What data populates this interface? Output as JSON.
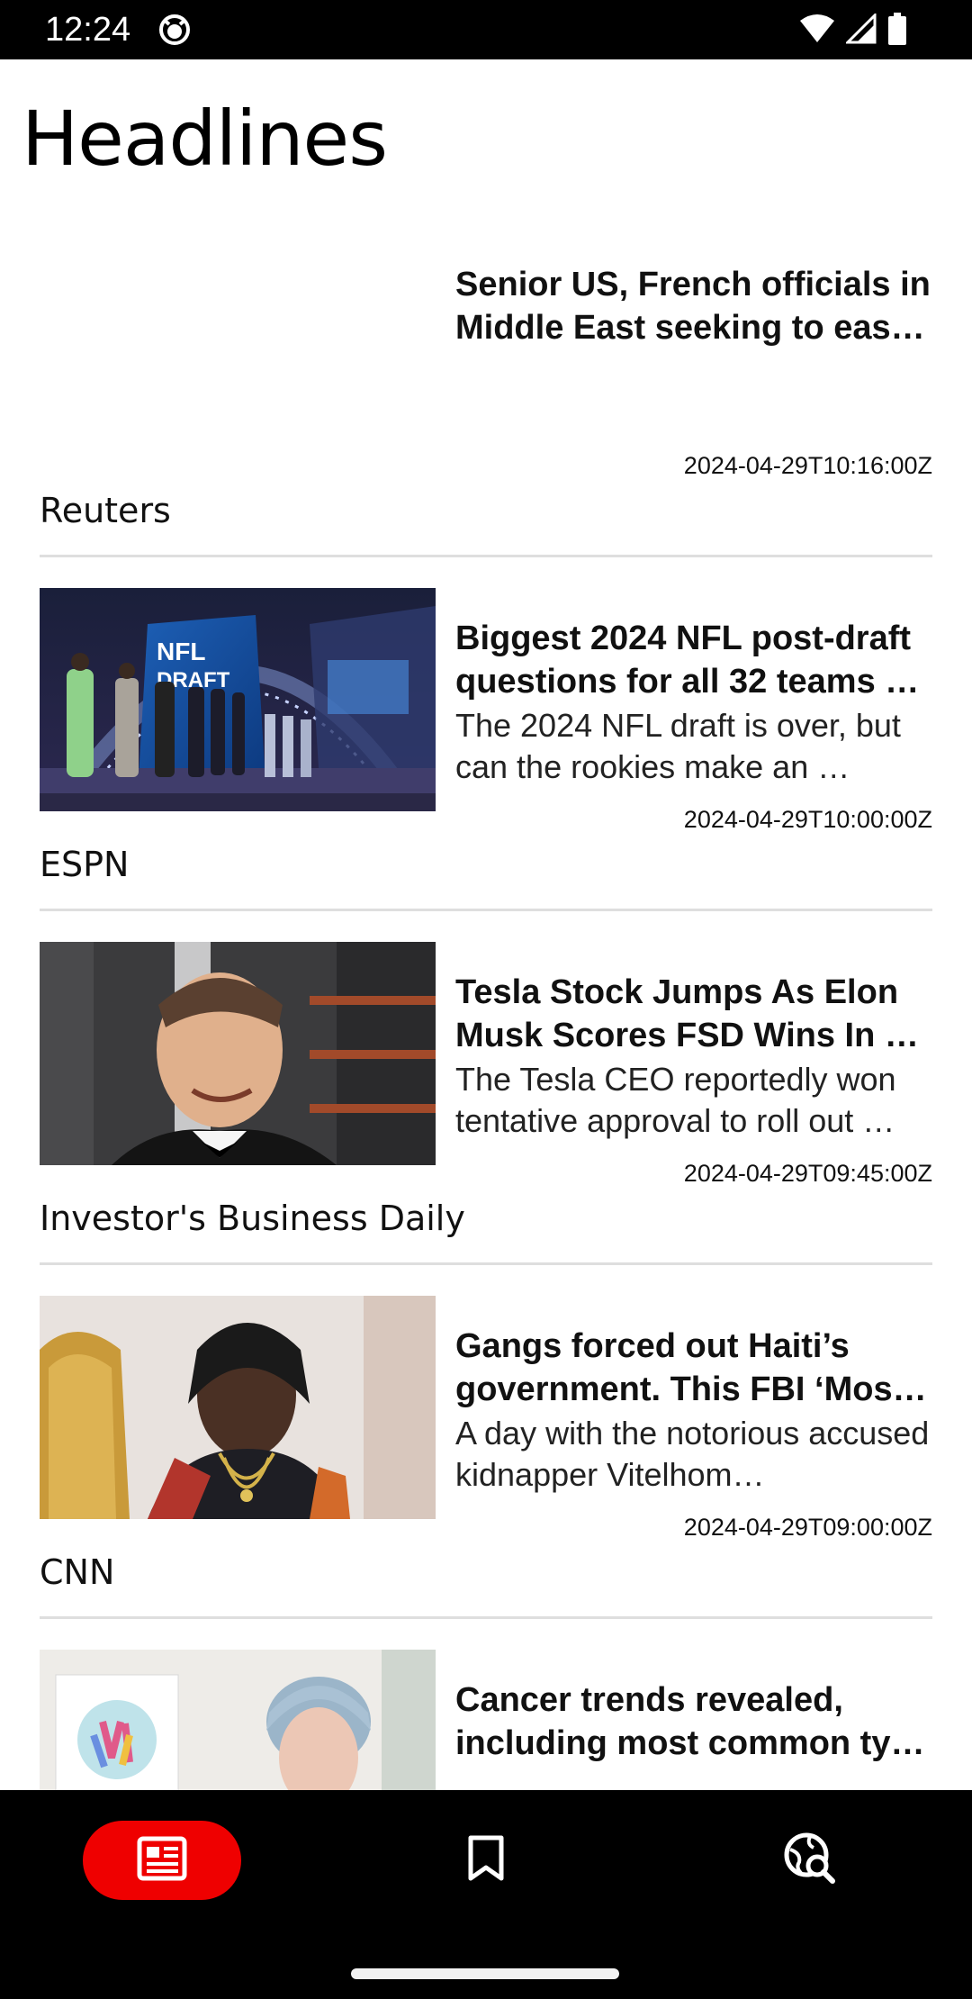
{
  "status_bar": {
    "time": "12:24",
    "icons": [
      "app-notification-icon",
      "wifi-icon",
      "cellular-signal-icon",
      "battery-icon"
    ]
  },
  "header": {
    "title": "Headlines"
  },
  "articles": [
    {
      "headline": "Senior US, French officials in Middle East seeking to eas…",
      "summary": "",
      "timestamp": "2024-04-29T10:16:00Z",
      "source": "Reuters",
      "has_image": false
    },
    {
      "headline": "Biggest 2024 NFL post-draft questions for all 32 teams …",
      "summary": "The 2024 NFL draft is over, but can the rookies make an …",
      "timestamp": "2024-04-29T10:00:00Z",
      "source": "ESPN",
      "has_image": true
    },
    {
      "headline": "Tesla Stock Jumps As Elon Musk Scores FSD Wins In …",
      "summary": "The Tesla CEO reportedly won tentative approval to roll out …",
      "timestamp": "2024-04-29T09:45:00Z",
      "source": "Investor's Business Daily",
      "has_image": true
    },
    {
      "headline": "Gangs forced out Haiti’s government. This FBI ‘Mos…",
      "summary": "A day with the notorious accused kidnapper Vitelhom…",
      "timestamp": "2024-04-29T09:00:00Z",
      "source": "CNN",
      "has_image": true
    },
    {
      "headline": "Cancer trends revealed, including most common ty…",
      "summary": "",
      "timestamp": "",
      "source": "",
      "has_image": true
    }
  ],
  "bottom_nav": {
    "items": [
      {
        "name": "headlines",
        "icon": "newspaper-icon",
        "active": true
      },
      {
        "name": "saved",
        "icon": "bookmark-icon",
        "active": false
      },
      {
        "name": "explore",
        "icon": "globe-search-icon",
        "active": false
      }
    ]
  },
  "colors": {
    "accent": "#ef0000",
    "nav_background": "#000000",
    "divider": "#dedede"
  }
}
